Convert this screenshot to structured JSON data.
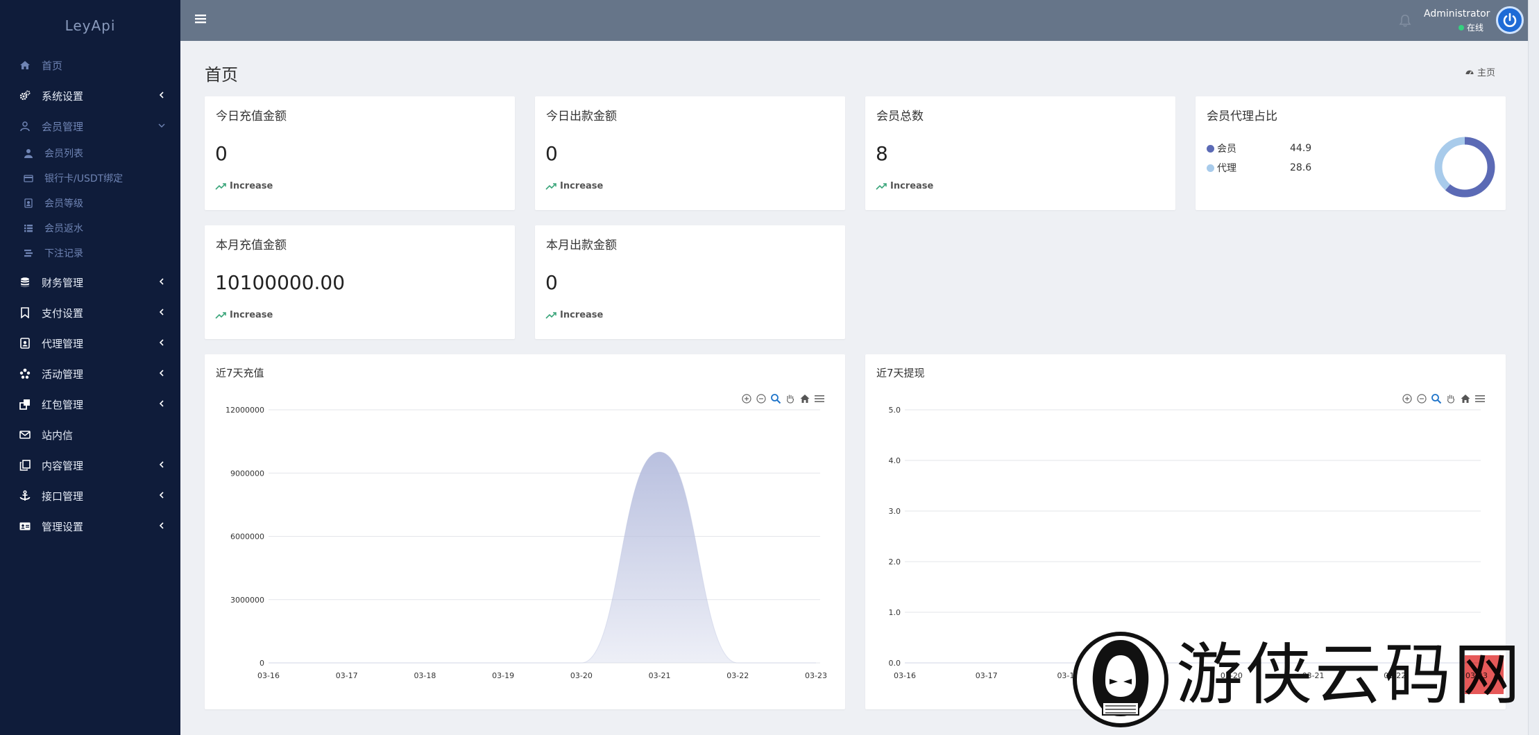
{
  "app": {
    "brand": "LeyApi"
  },
  "sidebar": {
    "items": [
      {
        "label": "首页",
        "icon": "home-icon"
      },
      {
        "label": "系统设置",
        "icon": "gears-icon"
      },
      {
        "label": "会员管理",
        "icon": "user-icon"
      },
      {
        "label": "财务管理",
        "icon": "database-icon"
      },
      {
        "label": "支付设置",
        "icon": "bookmark-icon"
      },
      {
        "label": "代理管理",
        "icon": "id-badge-icon"
      },
      {
        "label": "活动管理",
        "icon": "asterisk-icon"
      },
      {
        "label": "红包管理",
        "icon": "clone-icon"
      },
      {
        "label": "站内信",
        "icon": "envelope-icon"
      },
      {
        "label": "内容管理",
        "icon": "copy-icon"
      },
      {
        "label": "接口管理",
        "icon": "anchor-icon"
      },
      {
        "label": "管理设置",
        "icon": "id-card-icon"
      }
    ],
    "sub_items": [
      {
        "label": "会员列表",
        "icon": "user-solid-icon"
      },
      {
        "label": "银行卡/USDT绑定",
        "icon": "credit-card-icon"
      },
      {
        "label": "会员等级",
        "icon": "portrait-icon"
      },
      {
        "label": "会员返水",
        "icon": "list-icon"
      },
      {
        "label": "下注记录",
        "icon": "stream-icon"
      }
    ]
  },
  "header": {
    "user_name": "Administrator",
    "status": "在线"
  },
  "page": {
    "title": "首页",
    "breadcrumb": "主页"
  },
  "stats": [
    {
      "title": "今日充值金额",
      "value": "0",
      "trend": "Increase"
    },
    {
      "title": "今日出款金额",
      "value": "0",
      "trend": "Increase"
    },
    {
      "title": "会员总数",
      "value": "8",
      "trend": "Increase"
    },
    {
      "title": "本月充值金额",
      "value": "10100000.00",
      "trend": "Increase"
    },
    {
      "title": "本月出款金额",
      "value": "0",
      "trend": "Increase"
    }
  ],
  "ratio_card": {
    "title": "会员代理占比",
    "items": [
      {
        "label": "会员",
        "value": "44.9",
        "color": "#5b6ab5"
      },
      {
        "label": "代理",
        "value": "28.6",
        "color": "#a8cbeb"
      }
    ]
  },
  "chart_data": [
    {
      "type": "area",
      "title": "近7天充值",
      "categories": [
        "03-16",
        "03-17",
        "03-18",
        "03-19",
        "03-20",
        "03-21",
        "03-22",
        "03-23"
      ],
      "values": [
        0,
        0,
        0,
        0,
        0,
        10000000,
        0,
        0
      ],
      "yticks": [
        "0",
        "3000000",
        "6000000",
        "9000000",
        "12000000"
      ],
      "ylim": [
        0,
        12000000
      ],
      "grid": true,
      "color": "#b9c0df"
    },
    {
      "type": "area",
      "title": "近7天提现",
      "categories": [
        "03-16",
        "03-17",
        "03-18",
        "03-19",
        "03-20",
        "03-21",
        "03-22",
        "03-23"
      ],
      "values": [
        0,
        0,
        0,
        0,
        0,
        0,
        0,
        0
      ],
      "yticks": [
        "0.0",
        "1.0",
        "2.0",
        "3.0",
        "4.0",
        "5.0"
      ],
      "ylim": [
        0,
        5
      ],
      "grid": true,
      "color": "#b9c0df"
    }
  ],
  "watermark": {
    "text": "游侠云码网"
  }
}
